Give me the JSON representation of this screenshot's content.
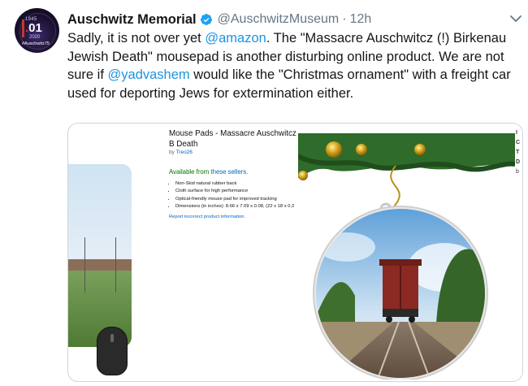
{
  "tweet": {
    "avatar_lines": {
      "year_top": "1945",
      "big": "01",
      "year_bottom": "2020",
      "hashtag": "#Auschwitz75"
    },
    "author_name": "Auschwitz Memorial",
    "handle": "@AuschwitzMuseum",
    "separator": "·",
    "time": "12h",
    "text": {
      "part1": "Sadly, it is not over yet ",
      "mention1": "@amazon",
      "part2": ". The \"Massacre Auschwitcz (!) Birkenau Jewish Death\" mousepad is another disturbing online product. We are not sure if ",
      "mention2": "@yadvashem",
      "part3": " would like the \"Christmas ornament\" with a freight car used for deporting Jews for extermination either."
    },
    "colors": {
      "link": "#1b95e0",
      "secondary": "#657786",
      "verified": "#1da1f2",
      "border": "#ccd6dd"
    }
  },
  "media": {
    "product": {
      "title": "Mouse Pads - Massacre Auschwitcz B Death",
      "by_prefix": "by ",
      "by_brand": "Treo26",
      "availability_prefix": "Available from ",
      "availability_link": "these sellers.",
      "bullets": [
        "Non-Skid natural rubber back",
        "Cloth surface for high performance",
        "Optical-friendly mouse pad for improved tracking",
        "Dimensions (in inches): 8.66 x 7.09 x 0.08, (22 x 18 x 0.2"
      ],
      "report_link": "Report incorrect product information."
    },
    "right_edge_letters": [
      "I",
      "C",
      "T",
      "D",
      "b"
    ]
  }
}
